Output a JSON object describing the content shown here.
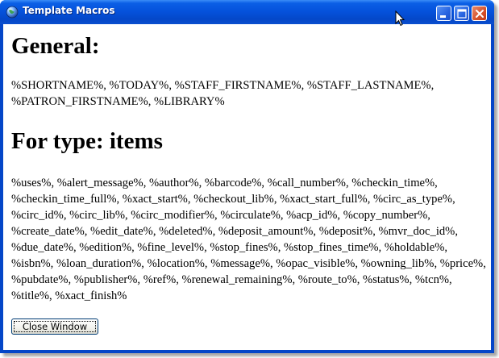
{
  "window": {
    "title": "Template Macros"
  },
  "content": {
    "general_heading": "General:",
    "general_macros": "%SHORTNAME%, %TODAY%, %STAFF_FIRSTNAME%, %STAFF_LASTNAME%, %PATRON_FIRSTNAME%, %LIBRARY%",
    "type_heading": "For type: items",
    "type_macros": "%uses%, %alert_message%, %author%, %barcode%, %call_number%, %checkin_time%, %checkin_time_full%, %xact_start%, %checkout_lib%, %xact_start_full%, %circ_as_type%, %circ_id%, %circ_lib%, %circ_modifier%, %circulate%, %acp_id%, %copy_number%, %create_date%, %edit_date%, %deleted%, %deposit_amount%, %deposit%, %mvr_doc_id%, %due_date%, %edition%, %fine_level%, %stop_fines%, %stop_fines_time%, %holdable%, %isbn%, %loan_duration%, %location%, %message%, %opac_visible%, %owning_lib%, %price%, %pubdate%, %publisher%, %ref%, %renewal_remaining%, %route_to%, %status%, %tcn%, %title%, %xact_finish%"
  },
  "buttons": {
    "close_window": "Close Window"
  },
  "icons": {
    "app": "globe-icon",
    "minimize": "minimize-icon",
    "maximize": "maximize-icon",
    "close": "close-icon",
    "cursor": "mouse-pointer-icon"
  }
}
